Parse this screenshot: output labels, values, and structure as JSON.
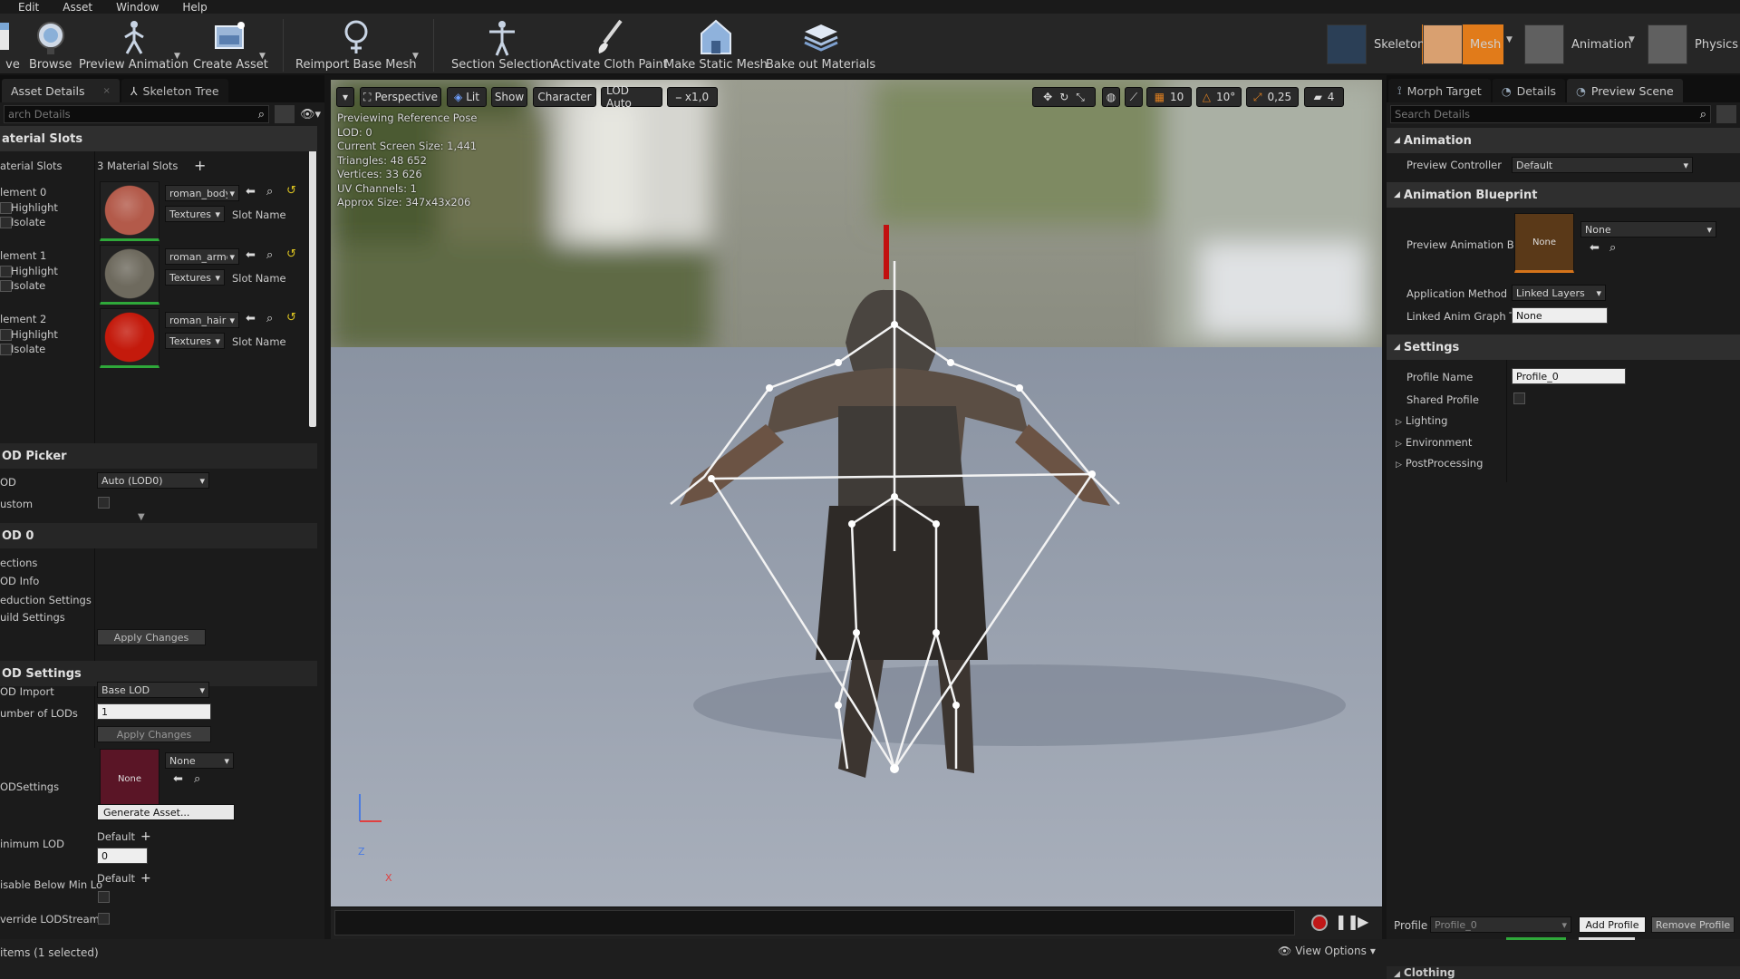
{
  "menu": [
    "Edit",
    "Asset",
    "Window",
    "Help"
  ],
  "toolbar": {
    "save_label": "ve",
    "browse": "Browse",
    "preview_animation": "Preview Animation",
    "create_asset": "Create Asset",
    "reimport": "Reimport Base Mesh",
    "section_selection": "Section Selection",
    "cloth_paint": "Activate Cloth Paint",
    "make_static": "Make Static Mesh",
    "bake_materials": "Bake out Materials"
  },
  "modes": {
    "skeleton": "Skeleton",
    "mesh": "Mesh",
    "animation": "Animation",
    "physics": "Physics"
  },
  "left": {
    "tabs": [
      "Asset Details",
      "Skeleton Tree"
    ],
    "search_placeholder": "arch Details",
    "material_slots_header": "aterial Slots",
    "material_slots_label": "aterial Slots",
    "material_slots_count": "3 Material Slots",
    "elements": [
      {
        "label": "lement 0",
        "material": "roman_body",
        "color": "#b35a4a"
      },
      {
        "label": "lement 1",
        "material": "roman_armor",
        "color": "#6e6a5e"
      },
      {
        "label": "lement 2",
        "material": "roman_hair",
        "color": "#c41a0c"
      }
    ],
    "highlight": "Highlight",
    "isolate": "Isolate",
    "textures": "Textures",
    "slot_name": "Slot Name",
    "lod_picker_header": "OD Picker",
    "lod_label": "OD",
    "lod_value": "Auto (LOD0)",
    "custom_label": "ustom",
    "lod0_header": "OD 0",
    "lod0_items": [
      "ections",
      "OD Info",
      "eduction Settings",
      "uild Settings"
    ],
    "apply_changes": "Apply Changes",
    "lod_settings_header": "OD Settings",
    "lod_import_label": "OD Import",
    "lod_import_value": "Base LOD",
    "num_lods_label": "umber of LODs",
    "num_lods_value": "1",
    "apply_changes2": "Apply Changes",
    "lodsettings_label": "ODSettings",
    "none": "None",
    "none_combo": "None",
    "generate_asset": "Generate Asset...",
    "min_lod_label": "inimum LOD",
    "default1": "Default",
    "min_lod_value": "0",
    "disable_below_label": "isable Below Min Lo",
    "default2": "Default",
    "override_label": "verride LODStreami"
  },
  "viewport": {
    "perspective": "Perspective",
    "lit": "Lit",
    "show": "Show",
    "character": "Character",
    "lod_auto": "LOD Auto",
    "speed": "x1,0",
    "grid": "10",
    "angle": "10°",
    "scale": "0,25",
    "cam": "4",
    "stats": [
      "Previewing Reference Pose",
      "LOD: 0",
      "Current Screen Size: 1,441",
      "Triangles: 48 652",
      "Vertices: 33 626",
      "UV Channels: 1",
      "Approx Size: 347x43x206"
    ],
    "axis_z": "Z",
    "axis_x": "X"
  },
  "right": {
    "tabs": [
      "Morph Target",
      "Details",
      "Preview Scene"
    ],
    "search_placeholder": "Search Details",
    "animation_header": "Animation",
    "preview_controller_label": "Preview Controller",
    "preview_controller_value": "Default",
    "anim_blueprint_header": "Animation Blueprint",
    "preview_anim_bp_label": "Preview Animation Bl",
    "none_thumb": "None",
    "none_combo": "None",
    "app_method_label": "Application Method",
    "app_method_value": "Linked Layers",
    "linked_tag_label": "Linked Anim Graph Ta",
    "linked_tag_value": "None",
    "settings_header": "Settings",
    "profile_name_label": "Profile Name",
    "profile_name_value": "Profile_0",
    "shared_profile_label": "Shared Profile",
    "lighting": "Lighting",
    "environment": "Environment",
    "postprocessing": "PostProcessing",
    "profile_label": "Profile",
    "profile_value": "Profile_0",
    "add_profile": "Add Profile",
    "remove_profile": "Remove Profile",
    "clothing": "Clothing"
  },
  "status": {
    "items": "items (1 selected)",
    "view_options": "View Options"
  }
}
